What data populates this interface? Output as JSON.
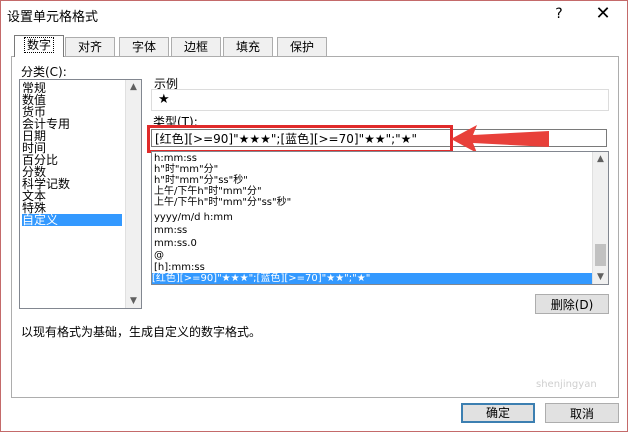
{
  "window": {
    "title": "设置单元格格式",
    "help": "?",
    "close": "✕"
  },
  "tabs": [
    {
      "label": "数字",
      "active": true
    },
    {
      "label": "对齐"
    },
    {
      "label": "字体"
    },
    {
      "label": "边框"
    },
    {
      "label": "填充"
    },
    {
      "label": "保护"
    }
  ],
  "category": {
    "label": "分类(C):",
    "items": [
      "常规",
      "数值",
      "货币",
      "会计专用",
      "日期",
      "时间",
      "百分比",
      "分数",
      "科学记数",
      "文本",
      "特殊",
      "自定义"
    ],
    "selected": "自定义"
  },
  "sample": {
    "label": "示例",
    "value": "★"
  },
  "type": {
    "label": "类型(T):",
    "value": "[红色][>=90]\"★★★\";[蓝色][>=70]\"★★\";\"★\""
  },
  "formats": [
    "h:mm:ss",
    "h\"时\"mm\"分\"",
    "h\"时\"mm\"分\"ss\"秒\"",
    "上午/下午h\"时\"mm\"分\"",
    "上午/下午h\"时\"mm\"分\"ss\"秒\"",
    "yyyy/m/d h:mm",
    "mm:ss",
    "mm:ss.0",
    "@",
    "[h]:mm:ss",
    "[红色][>=90]\"★★★\";[蓝色][>=70]\"★★\";\"★\""
  ],
  "buttons": {
    "delete": "删除(D)",
    "ok": "确定",
    "cancel": "取消"
  },
  "description": "以现有格式为基础，生成自定义的数字格式。",
  "watermark": "shenjingyan"
}
